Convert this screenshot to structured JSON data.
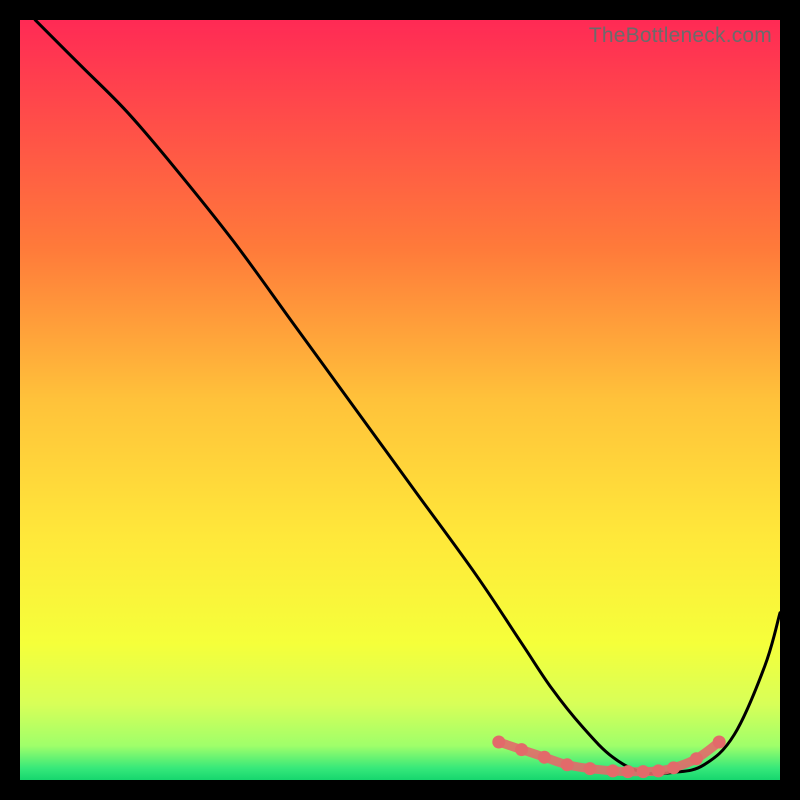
{
  "watermark": "TheBottleneck.com",
  "chart_data": {
    "type": "line",
    "title": "",
    "xlabel": "",
    "ylabel": "",
    "xlim": [
      0,
      100
    ],
    "ylim": [
      0,
      100
    ],
    "gradient_stops": [
      {
        "offset": 0.0,
        "color": "#ff2a55"
      },
      {
        "offset": 0.12,
        "color": "#ff4a4a"
      },
      {
        "offset": 0.3,
        "color": "#ff7a3a"
      },
      {
        "offset": 0.5,
        "color": "#ffc23a"
      },
      {
        "offset": 0.68,
        "color": "#ffe83a"
      },
      {
        "offset": 0.82,
        "color": "#f5ff3a"
      },
      {
        "offset": 0.9,
        "color": "#d8ff58"
      },
      {
        "offset": 0.955,
        "color": "#9fff6a"
      },
      {
        "offset": 0.985,
        "color": "#35e87a"
      },
      {
        "offset": 1.0,
        "color": "#16d66e"
      }
    ],
    "series": [
      {
        "name": "bottleneck-curve",
        "type": "line",
        "color": "#000000",
        "x": [
          2,
          8,
          14,
          20,
          28,
          36,
          44,
          52,
          60,
          66,
          70,
          74,
          78,
          82,
          86,
          90,
          94,
          98,
          100
        ],
        "values": [
          100,
          94,
          88,
          81,
          71,
          60,
          49,
          38,
          27,
          18,
          12,
          7,
          3,
          1,
          1,
          2,
          6,
          15,
          22
        ]
      },
      {
        "name": "optimal-range-markers",
        "type": "scatter",
        "color": "#e26a6a",
        "x": [
          63,
          66,
          69,
          72,
          75,
          78,
          80,
          82,
          84,
          86,
          89,
          92
        ],
        "values": [
          5,
          4,
          3,
          2,
          1.5,
          1.2,
          1.1,
          1.1,
          1.2,
          1.6,
          2.8,
          5
        ]
      }
    ],
    "annotations": []
  }
}
